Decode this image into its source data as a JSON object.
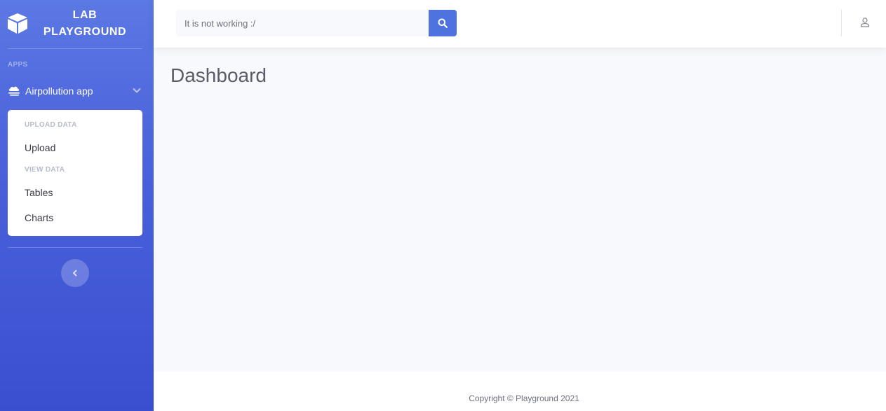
{
  "brand": {
    "line1": "LAB",
    "line2": "PLAYGROUND",
    "icon": "cube-icon"
  },
  "sidebar": {
    "heading": "APPS",
    "nav_item": {
      "label": "Airpollution app",
      "icon": "cloud-icon",
      "expanded": true
    },
    "collapse": {
      "groups": [
        {
          "header": "UPLOAD DATA",
          "items": [
            "Upload"
          ]
        },
        {
          "header": "VIEW DATA",
          "items": [
            "Tables",
            "Charts"
          ]
        }
      ]
    },
    "toggle_icon": "chevron-left-icon"
  },
  "search": {
    "value": "It is not working :/",
    "button_icon": "search-icon"
  },
  "topbar": {
    "user_icon": "user-icon"
  },
  "main": {
    "title": "Dashboard"
  },
  "footer": {
    "text": "Copyright © Playground 2021"
  },
  "colors": {
    "primary": "#4e73df",
    "sidebar_top": "#5b78e3",
    "sidebar_bottom": "#3a4fd0",
    "text_dark": "#5a5c69"
  }
}
